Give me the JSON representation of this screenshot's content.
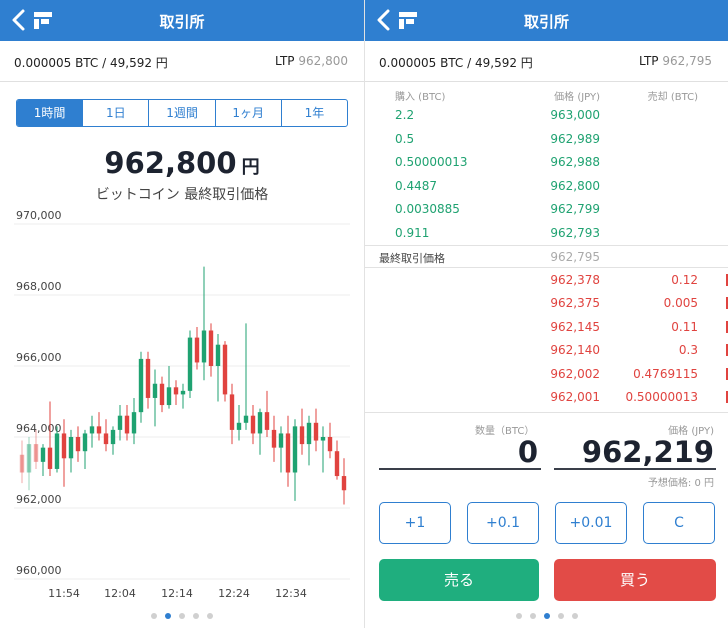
{
  "left": {
    "nav": {
      "title": "取引所"
    },
    "info": {
      "balance": "0.000005 BTC / 49,592 円",
      "ltp_label": "LTP",
      "ltp_value": "962,800"
    },
    "tabs": [
      {
        "label": "1時間",
        "active": true
      },
      {
        "label": "1日",
        "active": false
      },
      {
        "label": "1週間",
        "active": false
      },
      {
        "label": "1ヶ月",
        "active": false
      },
      {
        "label": "1年",
        "active": false
      }
    ],
    "price": {
      "value": "962,800",
      "unit": "円",
      "subtitle": "ビットコイン 最終取引価格"
    },
    "pager": {
      "count": 5,
      "active": 1
    }
  },
  "right": {
    "nav": {
      "title": "取引所"
    },
    "info": {
      "balance": "0.000005 BTC / 49,592 円",
      "ltp_label": "LTP",
      "ltp_value": "962,795"
    },
    "book_header": {
      "buy": "購入 (BTC)",
      "price": "価格 (JPY)",
      "sell": "売却 (BTC)"
    },
    "bids": [
      {
        "size": "2.2",
        "price": "963,000"
      },
      {
        "size": "0.5",
        "price": "962,989"
      },
      {
        "size": "0.50000013",
        "price": "962,988"
      },
      {
        "size": "0.4487",
        "price": "962,800"
      },
      {
        "size": "0.0030885",
        "price": "962,799"
      },
      {
        "size": "0.911",
        "price": "962,793"
      }
    ],
    "last_trade": {
      "label": "最終取引価格",
      "price": "962,795"
    },
    "asks": [
      {
        "price": "962,378",
        "size": "0.12"
      },
      {
        "price": "962,375",
        "size": "0.005"
      },
      {
        "price": "962,145",
        "size": "0.11"
      },
      {
        "price": "962,140",
        "size": "0.3"
      },
      {
        "price": "962,002",
        "size": "0.4769115"
      },
      {
        "price": "962,001",
        "size": "0.50000013"
      }
    ],
    "form": {
      "qty_label": "数量（BTC）",
      "qty_value": "0",
      "price_label": "価格 (JPY)",
      "price_value": "962,219",
      "estimate": "予想価格: 0 円"
    },
    "increments": [
      "+1",
      "+0.1",
      "+0.01",
      "C"
    ],
    "sell_label": "売る",
    "buy_label": "買う",
    "pager": {
      "count": 5,
      "active": 2
    }
  },
  "colors": {
    "nav": "#2f7fd0",
    "up": "#1fa271",
    "down": "#e0433f",
    "sell_button": "#1fae7e",
    "buy_button": "#e24b47"
  },
  "chart_data": {
    "type": "candlestick",
    "ylim": [
      960000,
      970000
    ],
    "y_ticks": [
      "970,000",
      "968,000",
      "966,000",
      "964,000",
      "962,000",
      "960,000"
    ],
    "y_tick_values": [
      970000,
      968000,
      966000,
      964000,
      962000,
      960000
    ],
    "x_ticks": [
      "11:54",
      "12:04",
      "12:14",
      "12:24",
      "12:34"
    ],
    "grid": true,
    "candles": [
      {
        "o": 963500,
        "h": 963900,
        "l": 962700,
        "c": 963000
      },
      {
        "o": 963000,
        "h": 964000,
        "l": 962500,
        "c": 963800
      },
      {
        "o": 963800,
        "h": 964200,
        "l": 963100,
        "c": 963300
      },
      {
        "o": 963300,
        "h": 963800,
        "l": 962900,
        "c": 963700
      },
      {
        "o": 963700,
        "h": 965000,
        "l": 962900,
        "c": 963100
      },
      {
        "o": 963100,
        "h": 964300,
        "l": 963000,
        "c": 964100
      },
      {
        "o": 964100,
        "h": 964500,
        "l": 962600,
        "c": 963400
      },
      {
        "o": 963400,
        "h": 964200,
        "l": 963000,
        "c": 964000
      },
      {
        "o": 964000,
        "h": 964300,
        "l": 963300,
        "c": 963600
      },
      {
        "o": 963600,
        "h": 964200,
        "l": 963100,
        "c": 964100
      },
      {
        "o": 964100,
        "h": 964600,
        "l": 963700,
        "c": 964300
      },
      {
        "o": 964300,
        "h": 964700,
        "l": 963900,
        "c": 964100
      },
      {
        "o": 964100,
        "h": 964500,
        "l": 963600,
        "c": 963800
      },
      {
        "o": 963800,
        "h": 964300,
        "l": 963500,
        "c": 964200
      },
      {
        "o": 964200,
        "h": 964900,
        "l": 963900,
        "c": 964600
      },
      {
        "o": 964600,
        "h": 964900,
        "l": 963900,
        "c": 964100
      },
      {
        "o": 964100,
        "h": 965100,
        "l": 963800,
        "c": 964700
      },
      {
        "o": 964700,
        "h": 966400,
        "l": 964400,
        "c": 966200
      },
      {
        "o": 966200,
        "h": 966400,
        "l": 964800,
        "c": 965100
      },
      {
        "o": 965100,
        "h": 965900,
        "l": 964300,
        "c": 965500
      },
      {
        "o": 965500,
        "h": 965700,
        "l": 964700,
        "c": 964900
      },
      {
        "o": 964900,
        "h": 966000,
        "l": 964800,
        "c": 965400
      },
      {
        "o": 965400,
        "h": 965600,
        "l": 964900,
        "c": 965200
      },
      {
        "o": 965200,
        "h": 965500,
        "l": 964800,
        "c": 965300
      },
      {
        "o": 965300,
        "h": 967000,
        "l": 965100,
        "c": 966800
      },
      {
        "o": 966800,
        "h": 967100,
        "l": 965900,
        "c": 966100
      },
      {
        "o": 966100,
        "h": 968800,
        "l": 965600,
        "c": 967000
      },
      {
        "o": 967000,
        "h": 967200,
        "l": 965700,
        "c": 966000
      },
      {
        "o": 966000,
        "h": 966900,
        "l": 965000,
        "c": 966600
      },
      {
        "o": 966600,
        "h": 966700,
        "l": 965000,
        "c": 965200
      },
      {
        "o": 965200,
        "h": 965500,
        "l": 963800,
        "c": 964200
      },
      {
        "o": 964200,
        "h": 964900,
        "l": 963900,
        "c": 964400
      },
      {
        "o": 964400,
        "h": 967200,
        "l": 964200,
        "c": 964600
      },
      {
        "o": 964600,
        "h": 964900,
        "l": 963800,
        "c": 964100
      },
      {
        "o": 964100,
        "h": 964800,
        "l": 963500,
        "c": 964700
      },
      {
        "o": 964700,
        "h": 965300,
        "l": 964000,
        "c": 964200
      },
      {
        "o": 964200,
        "h": 964600,
        "l": 963300,
        "c": 963700
      },
      {
        "o": 963700,
        "h": 964300,
        "l": 963000,
        "c": 964100
      },
      {
        "o": 964100,
        "h": 964600,
        "l": 962600,
        "c": 963000
      },
      {
        "o": 963000,
        "h": 964500,
        "l": 962200,
        "c": 964300
      },
      {
        "o": 964300,
        "h": 964800,
        "l": 963500,
        "c": 963800
      },
      {
        "o": 963800,
        "h": 964600,
        "l": 963200,
        "c": 964400
      },
      {
        "o": 964400,
        "h": 964800,
        "l": 963600,
        "c": 963900
      },
      {
        "o": 963900,
        "h": 964300,
        "l": 963000,
        "c": 964000
      },
      {
        "o": 964000,
        "h": 964400,
        "l": 963400,
        "c": 963600
      },
      {
        "o": 963600,
        "h": 963900,
        "l": 962800,
        "c": 962900
      },
      {
        "o": 962900,
        "h": 963400,
        "l": 962100,
        "c": 962500
      }
    ]
  }
}
